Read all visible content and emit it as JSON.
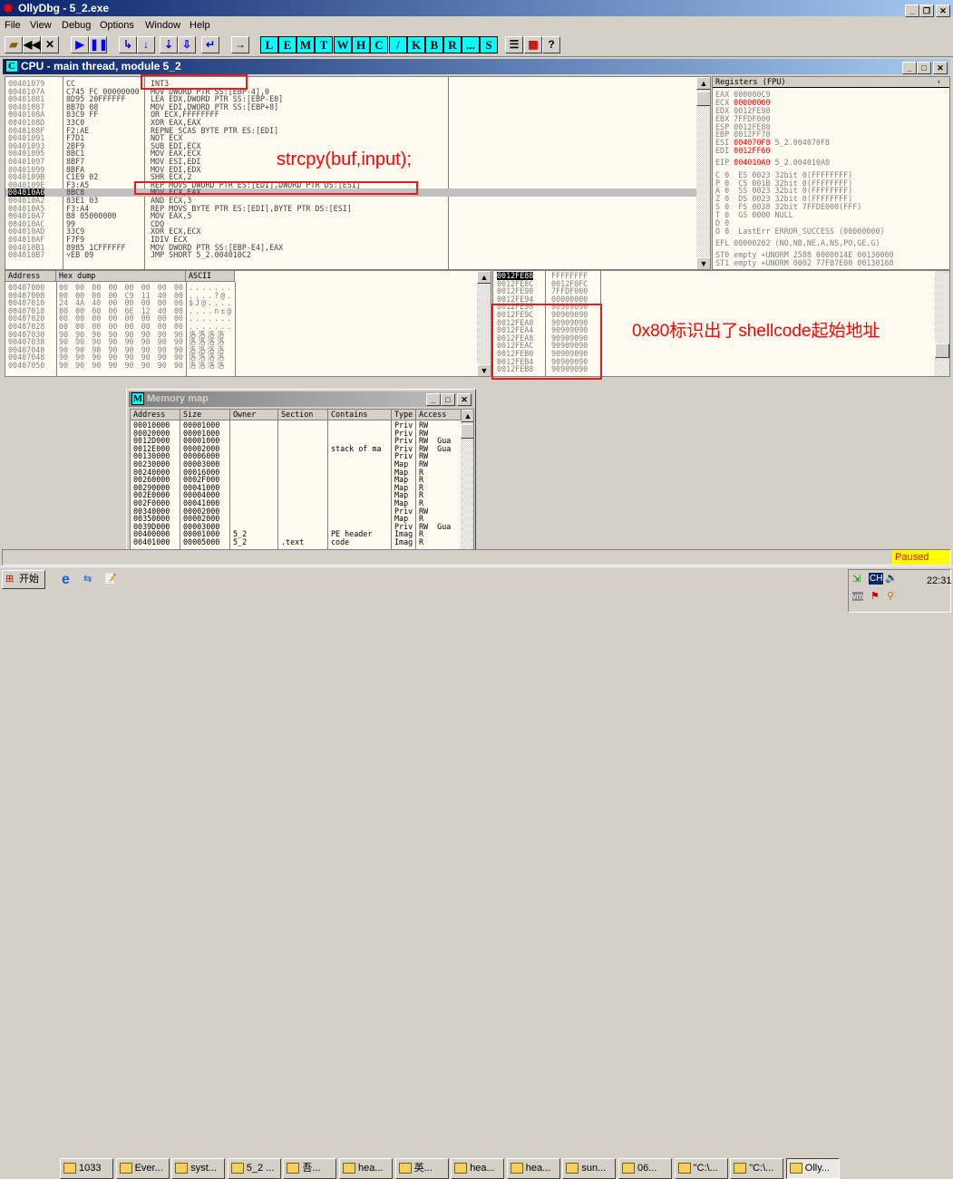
{
  "app": {
    "title": "OllyDbg - 5_2.exe"
  },
  "menu": [
    "File",
    "View",
    "Debug",
    "Options",
    "Window",
    "Help"
  ],
  "toolbar": {
    "letters": [
      "L",
      "E",
      "M",
      "T",
      "W",
      "H",
      "C",
      "/",
      "K",
      "B",
      "R",
      "...",
      "S"
    ]
  },
  "cpu": {
    "title": "CPU - main thread, module 5_2",
    "icon": "C",
    "disasm": [
      [
        "00401079",
        "CC",
        "INT3"
      ],
      [
        "0040107A",
        "C745 FC 00000000",
        "MOV DWORD PTR SS:[EBP-4],0"
      ],
      [
        "00401081",
        "8D95 20FFFFFF",
        "LEA EDX,DWORD PTR SS:[EBP-E0]"
      ],
      [
        "00401087",
        "8B7D 08",
        "MOV EDI,DWORD PTR SS:[EBP+8]"
      ],
      [
        "0040108A",
        "83C9 FF",
        "OR ECX,FFFFFFFF"
      ],
      [
        "0040108D",
        "33C0",
        "XOR EAX,EAX"
      ],
      [
        "0040108F",
        "F2:AE",
        "REPNE SCAS BYTE PTR ES:[EDI]"
      ],
      [
        "00401091",
        "F7D1",
        "NOT ECX"
      ],
      [
        "00401093",
        "2BF9",
        "SUB EDI,ECX"
      ],
      [
        "00401095",
        "8BC1",
        "MOV EAX,ECX"
      ],
      [
        "00401097",
        "8BF7",
        "MOV ESI,EDI"
      ],
      [
        "00401099",
        "8BFA",
        "MOV EDI,EDX"
      ],
      [
        "0040109B",
        "C1E9 02",
        "SHR ECX,2"
      ],
      [
        "0040109E",
        "F3:A5",
        "REP MOVS DWORD PTR ES:[EDI],DWORD PTR DS:[ESI]"
      ],
      [
        "004010A0",
        "8BC8",
        "MOV ECX,EAX"
      ],
      [
        "004010A2",
        "83E1 03",
        "AND ECX,3"
      ],
      [
        "004010A5",
        "F3:A4",
        "REP MOVS BYTE PTR ES:[EDI],BYTE PTR DS:[ESI]"
      ],
      [
        "004010A7",
        "B8 05000000",
        "MOV EAX,5"
      ],
      [
        "004010AC",
        "99",
        "CDQ"
      ],
      [
        "004010AD",
        "33C9",
        "XOR ECX,ECX"
      ],
      [
        "004010AF",
        "F7F9",
        "IDIV ECX"
      ],
      [
        "004010B1",
        "8985 1CFFFFFF",
        "MOV DWORD PTR SS:[EBP-E4],EAX"
      ],
      [
        "004010B7",
        "˅EB 09",
        "JMP SHORT 5_2.004010C2"
      ]
    ],
    "current_index": 14,
    "registers": {
      "header": "Registers (FPU)",
      "lines": [
        {
          "t": "EAX 000000C9"
        },
        {
          "t": "ECX ",
          "r": "00000000"
        },
        {
          "t": "EDX 0012FE98"
        },
        {
          "t": "EBX 7FFDF000"
        },
        {
          "t": "ESP 0012FE88"
        },
        {
          "t": "EBP 0012FF78"
        },
        {
          "t": "ESI ",
          "r": "004070F8",
          "s": " 5_2.004070F8"
        },
        {
          "t": "EDI ",
          "r": "0012FF60"
        },
        {
          "t": "",
          "gap": true
        },
        {
          "t": "EIP ",
          "r": "004010A0",
          "s": " 5_2.004010A0"
        },
        {
          "t": "",
          "gap": true
        },
        {
          "t": "C 0  ES 0023 32bit 0(FFFFFFFF)"
        },
        {
          "t": "P 0  CS 001B 32bit 0(FFFFFFFF)"
        },
        {
          "t": "A 0  SS 0023 32bit 0(FFFFFFFF)"
        },
        {
          "t": "Z 0  DS 0023 32bit 0(FFFFFFFF)"
        },
        {
          "t": "S 0  FS 0038 32bit 7FFDE000(FFF)"
        },
        {
          "t": "T 0  GS 0000 NULL"
        },
        {
          "t": "D 0"
        },
        {
          "t": "O 0  LastErr ERROR_SUCCESS (00000000)"
        },
        {
          "t": "",
          "gap": true
        },
        {
          "t": "EFL 00000202 (NO,NB,NE,A,NS,PO,GE,G)"
        },
        {
          "t": "",
          "gap": true
        },
        {
          "t": "ST0 empty +UNORM 2588 0000014E 00130000"
        },
        {
          "t": "ST1 empty +UNORM 0002 77FB7E00 00130168"
        }
      ]
    },
    "dump": {
      "headers": [
        "Address",
        "Hex dump",
        "ASCII"
      ],
      "rows": [
        [
          "00407000",
          "00 00 00 00 00 00 00 00",
          "........"
        ],
        [
          "00407008",
          "00 00 00 00 C9 11 40 00",
          "....?@."
        ],
        [
          "00407010",
          "24 4A 40 00 00 00 00 00",
          "$J@....."
        ],
        [
          "00407018",
          "00 00 00 00 6E 12 40 00",
          "....n±@."
        ],
        [
          "00407020",
          "00 00 00 00 00 00 00 00",
          "........"
        ],
        [
          "00407028",
          "00 00 00 00 00 00 00 00",
          "........"
        ],
        [
          "00407030",
          "90 90 90 90 90 90 90 90",
          "洛洛洛洛"
        ],
        [
          "00407038",
          "90 90 90 90 90 90 90 90",
          "洛洛洛洛"
        ],
        [
          "00407040",
          "90 90 90 90 90 90 90 90",
          "洛洛洛洛"
        ],
        [
          "00407048",
          "90 90 90 90 90 90 90 90",
          "洛洛洛洛"
        ],
        [
          "00407050",
          "90 90 90 90 90 90 90 90",
          "洛洛洛洛"
        ]
      ]
    },
    "stack": [
      [
        "0012FE88",
        "FFFFFFFF"
      ],
      [
        "0012FE8C",
        "0012F8FC"
      ],
      [
        "0012FE90",
        "7FFDF000"
      ],
      [
        "0012FE94",
        "00000000"
      ],
      [
        "0012FE98",
        "90909090"
      ],
      [
        "0012FE9C",
        "90909090"
      ],
      [
        "0012FEA0",
        "90909090"
      ],
      [
        "0012FEA4",
        "90909090"
      ],
      [
        "0012FEA8",
        "90909090"
      ],
      [
        "0012FEAC",
        "90909090"
      ],
      [
        "0012FEB0",
        "90909090"
      ],
      [
        "0012FEB4",
        "90909090"
      ],
      [
        "0012FEB8",
        "90909090"
      ]
    ]
  },
  "annotations": {
    "strcpy": "strcpy(buf,input);",
    "shellcode": "0x80标识出了shellcode起始地址"
  },
  "memmap": {
    "title": "Memory map",
    "icon": "M",
    "headers": [
      "Address",
      "Size",
      "Owner",
      "Section",
      "Contains",
      "Type",
      "Access"
    ],
    "rows": [
      [
        "00010000",
        "00001000",
        "",
        "",
        "",
        "Priv",
        "RW"
      ],
      [
        "00020000",
        "00001000",
        "",
        "",
        "",
        "Priv",
        "RW"
      ],
      [
        "0012D000",
        "00001000",
        "",
        "",
        "",
        "Priv",
        "RW  Gua"
      ],
      [
        "0012E000",
        "00002000",
        "",
        "",
        "stack of ma",
        "Priv",
        "RW  Gua"
      ],
      [
        "00130000",
        "00006000",
        "",
        "",
        "",
        "Priv",
        "RW"
      ],
      [
        "00230000",
        "00003000",
        "",
        "",
        "",
        "Map",
        "RW"
      ],
      [
        "00240000",
        "00016000",
        "",
        "",
        "",
        "Map",
        "R"
      ],
      [
        "00260000",
        "0002F000",
        "",
        "",
        "",
        "Map",
        "R"
      ],
      [
        "00290000",
        "00041000",
        "",
        "",
        "",
        "Map",
        "R"
      ],
      [
        "002E0000",
        "00004000",
        "",
        "",
        "",
        "Map",
        "R"
      ],
      [
        "002F0000",
        "00041000",
        "",
        "",
        "",
        "Map",
        "R"
      ],
      [
        "00340000",
        "00002000",
        "",
        "",
        "",
        "Priv",
        "RW"
      ],
      [
        "00350000",
        "00002000",
        "",
        "",
        "",
        "Map",
        "R"
      ],
      [
        "0039D000",
        "00003000",
        "",
        "",
        "",
        "Priv",
        "RW  Gua"
      ],
      [
        "00400000",
        "00001000",
        "5_2",
        "",
        "PE header",
        "Imag",
        "R"
      ],
      [
        "00401000",
        "00005000",
        "5_2",
        ".text",
        "code",
        "Imag",
        "R"
      ]
    ]
  },
  "status": {
    "state": "Paused",
    "color": "#ffff00"
  },
  "taskbar": {
    "start": "开始",
    "clock": "22:31",
    "ime": "CH",
    "tasks": [
      "1033",
      "Ever...",
      "syst...",
      "5_2 ...",
      "吾...",
      "hea...",
      "英...",
      "hea...",
      "hea...",
      "sun...",
      "06...",
      "\"C:\\...",
      "\"C:\\...",
      "Olly..."
    ]
  }
}
